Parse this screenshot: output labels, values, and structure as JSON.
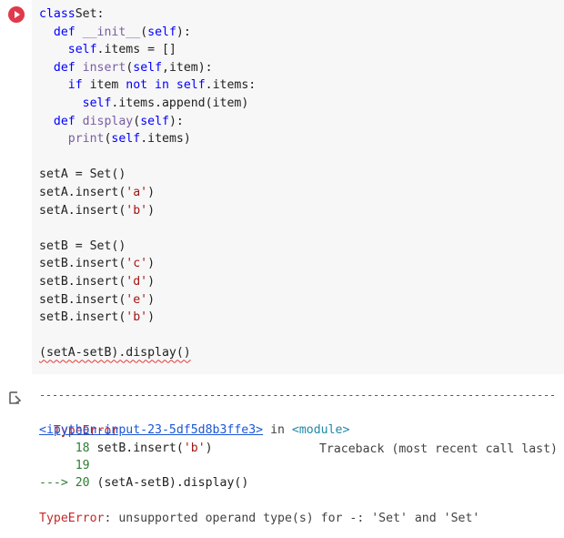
{
  "code": {
    "lines": [
      {
        "indent": "",
        "parts": [
          [
            "kw",
            "class"
          ],
          [
            "",
            "Set:"
          ]
        ]
      },
      {
        "indent": "  ",
        "parts": [
          [
            "kw",
            "def"
          ],
          [
            "",
            " "
          ],
          [
            "fn",
            "__init__"
          ],
          [
            "",
            "("
          ],
          [
            "self",
            "self"
          ],
          [
            "",
            "):"
          ]
        ]
      },
      {
        "indent": "    ",
        "parts": [
          [
            "self",
            "self"
          ],
          [
            "",
            ".items = []"
          ]
        ]
      },
      {
        "indent": "  ",
        "parts": [
          [
            "kw",
            "def"
          ],
          [
            "",
            " "
          ],
          [
            "fn",
            "insert"
          ],
          [
            "",
            "("
          ],
          [
            "self",
            "self"
          ],
          [
            "",
            ",item):"
          ]
        ]
      },
      {
        "indent": "    ",
        "parts": [
          [
            "kw",
            "if"
          ],
          [
            "",
            " item "
          ],
          [
            "kw",
            "not in"
          ],
          [
            "",
            " "
          ],
          [
            "self",
            "self"
          ],
          [
            "",
            ".items:"
          ]
        ]
      },
      {
        "indent": "      ",
        "parts": [
          [
            "self",
            "self"
          ],
          [
            "",
            ".items.append(item)"
          ]
        ]
      },
      {
        "indent": "  ",
        "parts": [
          [
            "kw",
            "def"
          ],
          [
            "",
            " "
          ],
          [
            "fn",
            "display"
          ],
          [
            "",
            "("
          ],
          [
            "self",
            "self"
          ],
          [
            "",
            "):"
          ]
        ]
      },
      {
        "indent": "    ",
        "parts": [
          [
            "fn",
            "print"
          ],
          [
            "",
            "("
          ],
          [
            "self",
            "self"
          ],
          [
            "",
            ".items)"
          ]
        ]
      },
      {
        "indent": "",
        "parts": []
      },
      {
        "indent": "",
        "parts": [
          [
            "",
            "setA = Set()"
          ]
        ]
      },
      {
        "indent": "",
        "parts": [
          [
            "",
            "setA.insert("
          ],
          [
            "str",
            "'a'"
          ],
          [
            "",
            ")"
          ]
        ]
      },
      {
        "indent": "",
        "parts": [
          [
            "",
            "setA.insert("
          ],
          [
            "str",
            "'b'"
          ],
          [
            "",
            ")"
          ]
        ]
      },
      {
        "indent": "",
        "parts": []
      },
      {
        "indent": "",
        "parts": [
          [
            "",
            "setB = Set()"
          ]
        ]
      },
      {
        "indent": "",
        "parts": [
          [
            "",
            "setB.insert("
          ],
          [
            "str",
            "'c'"
          ],
          [
            "",
            ")"
          ]
        ]
      },
      {
        "indent": "",
        "parts": [
          [
            "",
            "setB.insert("
          ],
          [
            "str",
            "'d'"
          ],
          [
            "",
            ")"
          ]
        ]
      },
      {
        "indent": "",
        "parts": [
          [
            "",
            "setB.insert("
          ],
          [
            "str",
            "'e'"
          ],
          [
            "",
            ")"
          ]
        ]
      },
      {
        "indent": "",
        "parts": [
          [
            "",
            "setB.insert("
          ],
          [
            "str",
            "'b'"
          ],
          [
            "",
            ")"
          ]
        ]
      },
      {
        "indent": "",
        "parts": []
      },
      {
        "indent": "",
        "parts": [
          [
            "squiggle",
            "(setA-setB).display()"
          ]
        ]
      }
    ]
  },
  "output": {
    "dashes": "--------------------------------------------------------------------------------------------",
    "error_name": "TypeError",
    "traceback_label": "Traceback (most recent call last)",
    "input_link": "<ipython-input-23-5df5d8b3ffe3>",
    "in_text": " in ",
    "module_text": "<module>",
    "line18_num": "     18 ",
    "line18_code_pre": "setB.insert(",
    "line18_code_str": "'b'",
    "line18_code_post": ")",
    "line19_num": "     19",
    "arrow_num": "---> 20 ",
    "line20_code": "(setA-setB).display()",
    "final_error_name": "TypeError",
    "final_error_msg": ": unsupported operand type(s) for -: 'Set' and 'Set'"
  },
  "colors": {
    "run_button": "#e0394b",
    "keyword": "#0000ff",
    "string": "#a31515",
    "error": "#c62828",
    "line_number": "#2e7d32",
    "link": "#1a56d6"
  },
  "icons": {
    "run": "play-circle-icon",
    "output": "output-arrow-icon"
  }
}
